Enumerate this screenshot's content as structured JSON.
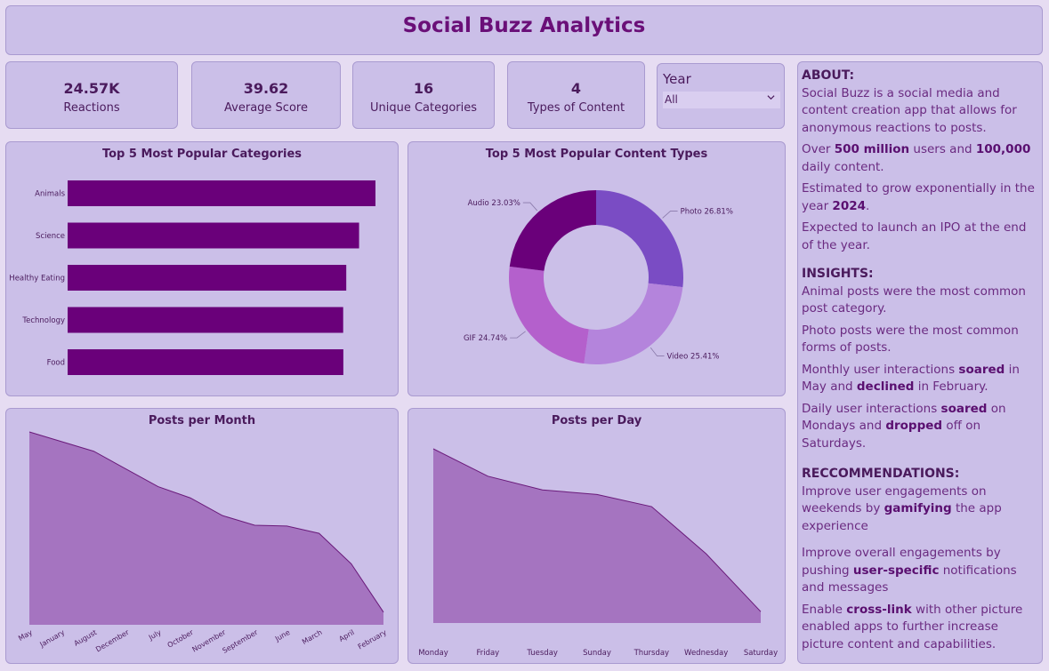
{
  "header": {
    "title": "Social Buzz Analytics"
  },
  "kpis": [
    {
      "value": "24.57K",
      "label": "Reactions"
    },
    {
      "value": "39.62",
      "label": "Average Score"
    },
    {
      "value": "16",
      "label": "Unique Categories"
    },
    {
      "value": "4",
      "label": "Types of Content"
    }
  ],
  "filter": {
    "label": "Year",
    "selected": "All"
  },
  "colors": {
    "bar": "#6a007a",
    "area_fill": "#a574c0",
    "area_line": "#6a1a7a",
    "audio": "#6a007a",
    "photo": "#7a4cc4",
    "video": "#b484dc",
    "gif": "#b460cc"
  },
  "charts": [
    {
      "type": "bar",
      "title": "Top 5 Most Popular Categories",
      "categories": [
        "Animals",
        "Science",
        "Healthy Eating",
        "Technology",
        "Food"
      ],
      "values": [
        1897,
        1796,
        1717,
        1698,
        1699
      ]
    },
    {
      "type": "pie",
      "title": "Top 5 Most Popular Content Types",
      "slices": [
        {
          "label": "Photo",
          "value": 26.81,
          "text": "Photo 26.81%"
        },
        {
          "label": "Video",
          "value": 25.41,
          "text": "Video 25.41%"
        },
        {
          "label": "GIF",
          "value": 24.74,
          "text": "GIF 24.74%"
        },
        {
          "label": "Audio",
          "value": 23.03,
          "text": "Audio 23.03%"
        }
      ]
    },
    {
      "type": "area",
      "title": "Posts per Month",
      "categories": [
        "May",
        "January",
        "August",
        "December",
        "July",
        "October",
        "November",
        "September",
        "June",
        "March",
        "April",
        "February"
      ],
      "values": [
        2138,
        2126,
        2114,
        2092,
        2070,
        2056,
        2034,
        2022,
        2021,
        2012,
        1974,
        1914
      ]
    },
    {
      "type": "area",
      "title": "Posts per Day",
      "categories": [
        "Monday",
        "Friday",
        "Tuesday",
        "Sunday",
        "Thursday",
        "Wednesday",
        "Saturday"
      ],
      "values": [
        3752,
        3716,
        3698,
        3692,
        3676,
        3614,
        3538
      ]
    }
  ],
  "about": {
    "h_about": "ABOUT:",
    "p1": "Social Buzz is a social media and content creation app that allows for anonymous reactions to posts.",
    "p2_a": "Over ",
    "p2_b": "500 million",
    "p2_c": " users and ",
    "p2_d": "100,000",
    "p2_e": " daily content.",
    "p3_a": "Estimated to grow exponentially in the year ",
    "p3_b": "2024",
    "p3_c": ".",
    "p4": "Expected to launch an IPO at the end of the year.",
    "h_insights": "INSIGHTS:",
    "i1": "Animal posts were the most common post category.",
    "i2": "Photo posts were the most common forms of posts.",
    "i3_a": "Monthly user interactions ",
    "i3_b": "soared",
    "i3_c": " in May and ",
    "i3_d": "declined",
    "i3_e": " in February.",
    "i4_a": "Daily user interactions ",
    "i4_b": "soared",
    "i4_c": " on Mondays and ",
    "i4_d": "dropped",
    "i4_e": " off on Saturdays.",
    "h_rec": "RECCOMMENDATIONS:",
    "r1_a": "Improve user engagements on weekends by ",
    "r1_b": "gamifying",
    "r1_c": " the app experience",
    "r2_a": "Improve overall engagements by pushing ",
    "r2_b": "user-specific",
    "r2_c": " notifications and messages",
    "r3_a": "Enable ",
    "r3_b": "cross-link",
    "r3_c": " with other picture enabled apps to further increase picture content and capabilities."
  }
}
